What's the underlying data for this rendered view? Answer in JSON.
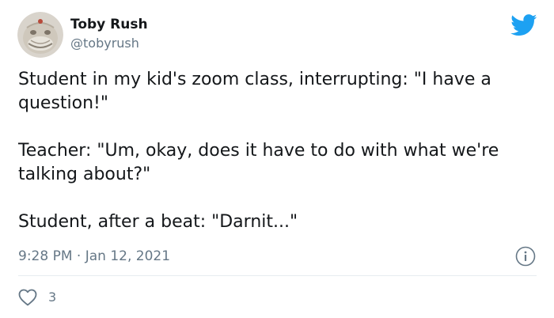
{
  "author": {
    "display_name": "Toby Rush",
    "handle": "@tobyrush"
  },
  "tweet": {
    "paragraphs": [
      "Student in my kid's zoom class, interrupting: \"I have a question!\"",
      "Teacher: \"Um, okay, does it have to do with what we're talking about?\"",
      "Student, after a beat: \"Darnit...\""
    ],
    "timestamp": "9:28 PM · Jan 12, 2021"
  },
  "engagement": {
    "likes": "3"
  },
  "icons": {
    "brand": "twitter-bird-icon",
    "info": "info-icon",
    "like": "heart-icon"
  },
  "colors": {
    "twitter_blue": "#1da1f2",
    "text": "#14171a",
    "secondary_text": "#657786",
    "divider": "#e6ecf0"
  }
}
